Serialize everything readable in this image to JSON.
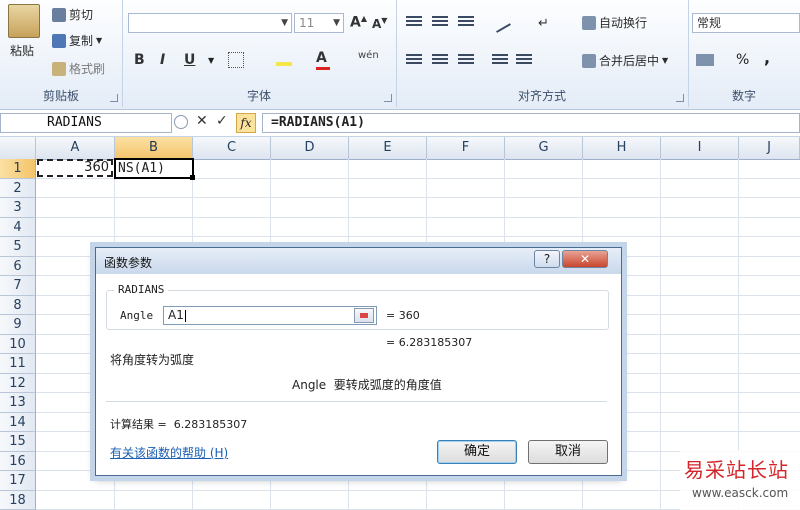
{
  "ribbon": {
    "clipboard": {
      "paste": "粘贴",
      "cut": "剪切",
      "copy": "复制",
      "format_painter": "格式刷",
      "label": "剪贴板"
    },
    "font": {
      "font_name": "",
      "font_size": "11",
      "grow": "A",
      "shrink": "A",
      "bold": "B",
      "italic": "I",
      "underline": "U",
      "font_color": "A",
      "phonetic": "wén",
      "label": "字体"
    },
    "alignment": {
      "wrap_text": "自动换行",
      "merge_center": "合并后居中",
      "label": "对齐方式"
    },
    "number": {
      "format": "常规",
      "percent": "%",
      "comma": ",",
      "label": "数字"
    }
  },
  "formula_bar": {
    "name_box": "RADIANS",
    "cancel": "✕",
    "enter": "✓",
    "fx": "fx",
    "formula": "=RADIANS(A1)"
  },
  "sheet": {
    "columns": [
      "A",
      "B",
      "C",
      "D",
      "E",
      "F",
      "G",
      "H",
      "I",
      "J"
    ],
    "rows": [
      "1",
      "2",
      "3",
      "4",
      "5",
      "6",
      "7",
      "8",
      "9",
      "10",
      "11",
      "12",
      "13",
      "14",
      "15",
      "16",
      "17",
      "18"
    ],
    "cell_a1": "360",
    "cell_b1": "NS(A1)"
  },
  "dialog": {
    "title": "函数参数",
    "help_btn": "?",
    "close_btn": "✕",
    "function_name": "RADIANS",
    "arg_label": "Angle",
    "arg_value": "A1",
    "arg_result": "= 360",
    "func_result": "= 6.283185307",
    "description": "将角度转为弧度",
    "arg_description": "Angle  要转成弧度的角度值",
    "calc_result": "计算结果 =  6.283185307",
    "help_link": "有关该函数的帮助 (H)",
    "ok": "确定",
    "cancel": "取消"
  },
  "watermark": {
    "text": "易采站长站",
    "url": "www.easck.com"
  }
}
